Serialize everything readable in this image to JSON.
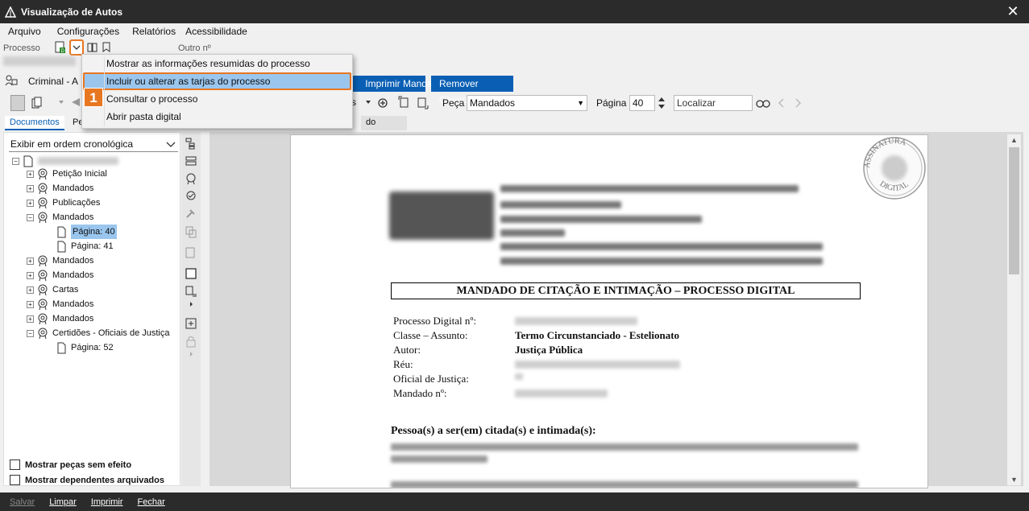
{
  "window": {
    "title": "Visualização de Autos"
  },
  "menu": {
    "arquivo": "Arquivo",
    "configuracoes": "Configurações",
    "relatorios": "Relatórios",
    "acessibilidade": "Acessibilidade"
  },
  "header": {
    "processo_label": "Processo",
    "outro_label": "Outro nº",
    "criminal": "Criminal - A"
  },
  "buttons": {
    "imprimir_mandado": "Imprimir Mandado",
    "remover_objeto": "Remover Objeto"
  },
  "toolbar": {
    "peca_label": "Peça",
    "peca_value": "Mandados",
    "pagina_label": "Página",
    "pagina_value": "40",
    "localizar_placeholder": "Localizar",
    "zoom_suffix": "s"
  },
  "tabs": {
    "documentos": "Documentos",
    "pe": "Pe",
    "do_processo": "do processo"
  },
  "sort": {
    "value": "Exibir em ordem cronológica"
  },
  "tree": [
    {
      "label": "Petição Inicial"
    },
    {
      "label": "Mandados"
    },
    {
      "label": "Publicações"
    },
    {
      "label": "Mandados"
    },
    {
      "label": "Página: 40"
    },
    {
      "label": "Página: 41"
    },
    {
      "label": "Mandados"
    },
    {
      "label": "Mandados"
    },
    {
      "label": "Cartas"
    },
    {
      "label": "Mandados"
    },
    {
      "label": "Mandados"
    },
    {
      "label": "Certidões - Oficiais de Justiça"
    },
    {
      "label": "Página: 52"
    }
  ],
  "checks": {
    "sem_efeito": "Mostrar peças sem efeito",
    "dependentes": "Mostrar dependentes arquivados"
  },
  "popup": {
    "items": [
      "Mostrar as informações resumidas do processo",
      "Incluir ou alterar as tarjas do processo",
      "Consultar o processo",
      "Abrir pasta digital"
    ],
    "badge": "1"
  },
  "document": {
    "title": "MANDADO DE CITAÇÃO E INTIMAÇÃO – PROCESSO DIGITAL",
    "labels": [
      "Processo Digital nº:",
      "Classe – Assunto:",
      "Autor:",
      "Réu:",
      "Oficial de Justiça:",
      "Mandado nº:"
    ],
    "classe_value": "Termo Circunstanciado - Estelionato",
    "autor_value": "Justiça Pública",
    "pessoas_heading": "Pessoa(s) a ser(em) citada(s) e intimada(s):",
    "stamp_top": "ASSINATURA",
    "stamp_bottom": "DIGITAL"
  },
  "statusbar": {
    "salvar": "Salvar",
    "limpar": "Limpar",
    "imprimir": "Imprimir",
    "fechar": "Fechar"
  }
}
